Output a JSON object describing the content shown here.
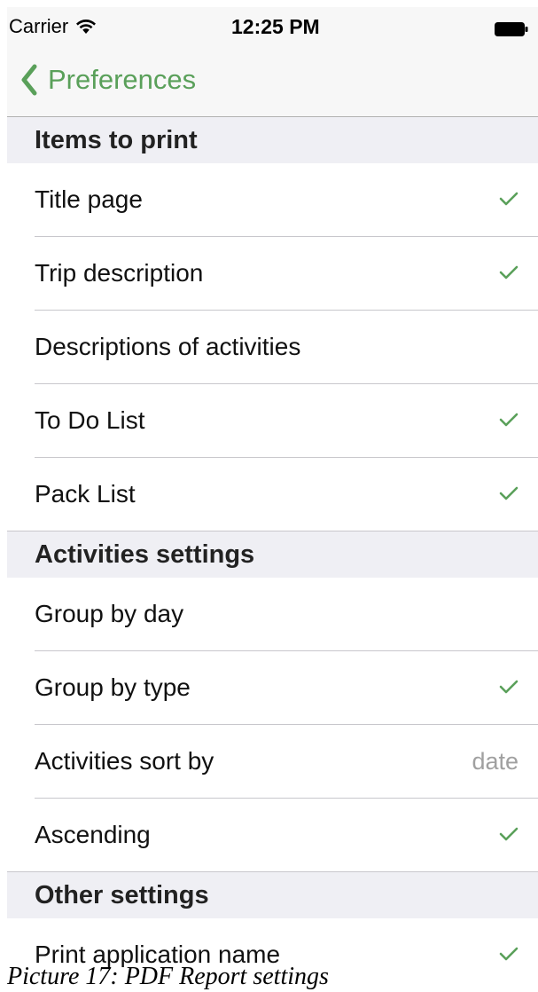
{
  "status_bar": {
    "carrier": "Carrier",
    "time": "12:25 PM",
    "wifi_icon": "wifi-icon",
    "battery_icon": "battery-full-icon"
  },
  "nav": {
    "back_label": "Preferences",
    "back_icon": "chevron-left-icon"
  },
  "colors": {
    "accent": "#5aa05a",
    "section_bg": "#efeff4",
    "secondary_text": "#a0a0a0"
  },
  "sections": [
    {
      "title": "Items to print",
      "rows": [
        {
          "label": "Title page",
          "checked": true
        },
        {
          "label": "Trip description",
          "checked": true
        },
        {
          "label": "Descriptions of activities",
          "checked": false
        },
        {
          "label": "To Do List",
          "checked": true
        },
        {
          "label": "Pack List",
          "checked": true
        }
      ]
    },
    {
      "title": "Activities settings",
      "rows": [
        {
          "label": "Group by day",
          "checked": false
        },
        {
          "label": "Group by type",
          "checked": true
        },
        {
          "label": "Activities sort by",
          "checked": false,
          "value": "date"
        },
        {
          "label": "Ascending",
          "checked": true
        }
      ]
    },
    {
      "title": "Other settings",
      "rows": [
        {
          "label": "Print application name",
          "checked": true
        }
      ]
    }
  ],
  "caption": "Picture 17: PDF Report settings"
}
